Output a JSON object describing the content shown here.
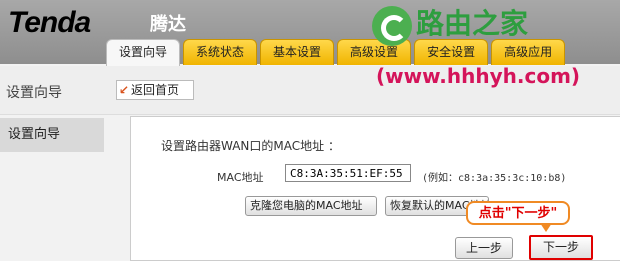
{
  "header": {
    "brand": "Tenda",
    "brand_cn": "腾达",
    "tabs": [
      {
        "label": "设置向导",
        "active": true
      },
      {
        "label": "系统状态",
        "active": false
      },
      {
        "label": "基本设置",
        "active": false
      },
      {
        "label": "高级设置",
        "active": false
      },
      {
        "label": "安全设置",
        "active": false
      },
      {
        "label": "高级应用",
        "active": false
      }
    ]
  },
  "watermark": {
    "brand": "路由之家",
    "url": "(www.hhhyh.com)"
  },
  "toolbar": {
    "section_title": "设置向导",
    "back_label": "返回首页"
  },
  "sidebar": {
    "items": [
      {
        "label": "设置向导"
      }
    ]
  },
  "main": {
    "title": "设置路由器WAN口的MAC地址 ：",
    "mac_label": "MAC地址",
    "mac_value": "C8:3A:35:51:EF:55",
    "mac_example": "(例如：c8:3a:35:3c:10:b8)",
    "clone_button": "克隆您电脑的MAC地址",
    "restore_button": "恢复默认的MAC地址",
    "prev_button": "上一步",
    "next_button": "下一步"
  },
  "annotation": {
    "callout": "点击\"下一步\""
  },
  "colors": {
    "tab_gold": "#f0b400",
    "callout_border": "#f08a24",
    "highlight_red": "#e00000",
    "watermark_green": "#2e9e3f",
    "watermark_url": "#d4145a"
  }
}
